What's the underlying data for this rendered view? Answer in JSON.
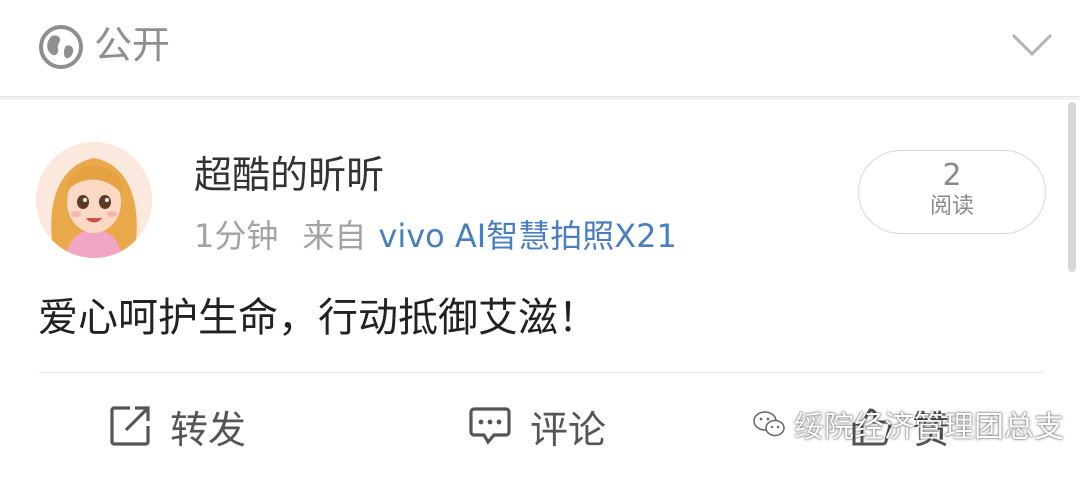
{
  "visibility": {
    "label": "公开",
    "icon": "globe-icon"
  },
  "post": {
    "author": "超酷的昕昕",
    "time": "1分钟",
    "source_prefix": "来自",
    "device": "vivo AI智慧拍照X21",
    "text": "爱心呵护生命，行动抵御艾滋！",
    "reads": {
      "count": "2",
      "label": "阅读"
    }
  },
  "actions": {
    "repost_label": "转发",
    "comment_label": "评论",
    "like_label": "赞"
  },
  "watermark": {
    "text": "绥院经济管理团总支"
  },
  "colors": {
    "link": "#4a7fbf",
    "meta": "#a3a3a3",
    "background": "#f2f2f2"
  }
}
